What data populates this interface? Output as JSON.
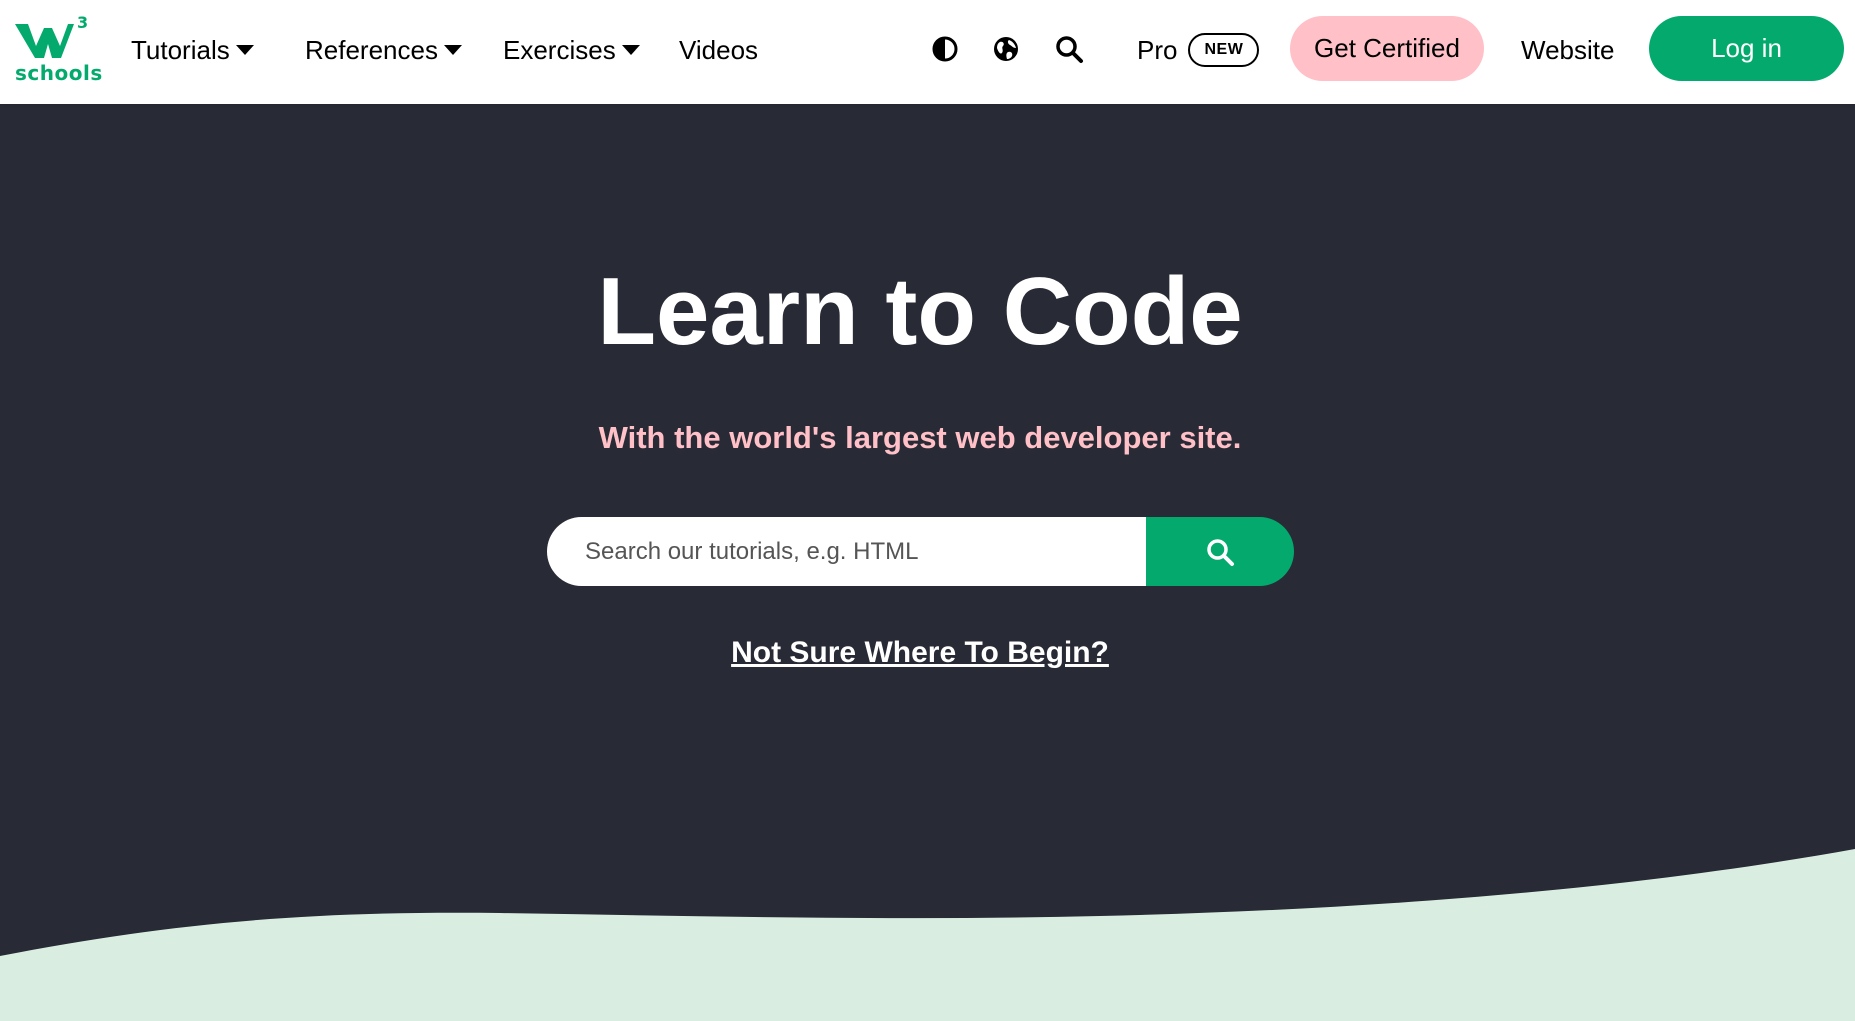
{
  "brand": {
    "logo_text": "schools",
    "logo_superscript": "3",
    "logo_color": "#04aa6d"
  },
  "nav": {
    "items": [
      {
        "label": "Tutorials",
        "has_dropdown": true
      },
      {
        "label": "References",
        "has_dropdown": true
      },
      {
        "label": "Exercises",
        "has_dropdown": true
      },
      {
        "label": "Videos",
        "has_dropdown": false
      }
    ],
    "icons": [
      "contrast-icon",
      "globe-icon",
      "search-icon"
    ],
    "pro_label": "Pro",
    "new_badge": "NEW",
    "certified_label": "Get Certified",
    "website_label": "Website",
    "login_label": "Log in"
  },
  "hero": {
    "title": "Learn to Code",
    "subtitle": "With the world's largest web developer site.",
    "search_placeholder": "Search our tutorials, e.g. HTML",
    "begin_link": "Not Sure Where To Begin?"
  },
  "colors": {
    "accent_green": "#04aa6d",
    "pink": "#ffc0c7",
    "hero_bg": "#282a35",
    "wave": "#d9eee1"
  }
}
